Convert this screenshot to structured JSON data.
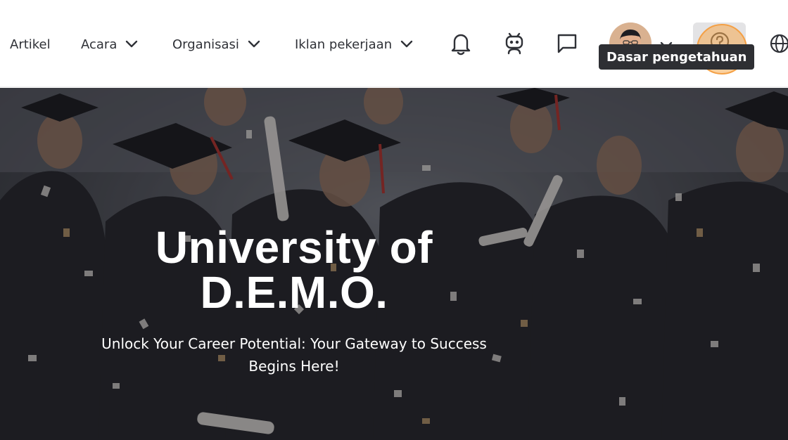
{
  "nav": {
    "items": [
      {
        "label": "Artikel"
      },
      {
        "label": "Acara"
      },
      {
        "label": "Organisasi"
      },
      {
        "label": "Iklan pekerjaan"
      }
    ],
    "icons": [
      "bell-icon",
      "robot-icon",
      "chat-icon",
      "chevron-down-icon",
      "help-icon",
      "globe-icon"
    ],
    "tooltip": "Dasar pengetahuan"
  },
  "hero": {
    "title_line1": "University of",
    "title_line2": "D.E.M.O.",
    "subtitle_line1": "Unlock Your Career Potential: Your Gateway to Success",
    "subtitle_line2": "Begins Here!"
  },
  "colors": {
    "accent_focus": "#f4a045",
    "tooltip_bg": "#2e2f33",
    "hero_overlay": "#3a3b40"
  }
}
